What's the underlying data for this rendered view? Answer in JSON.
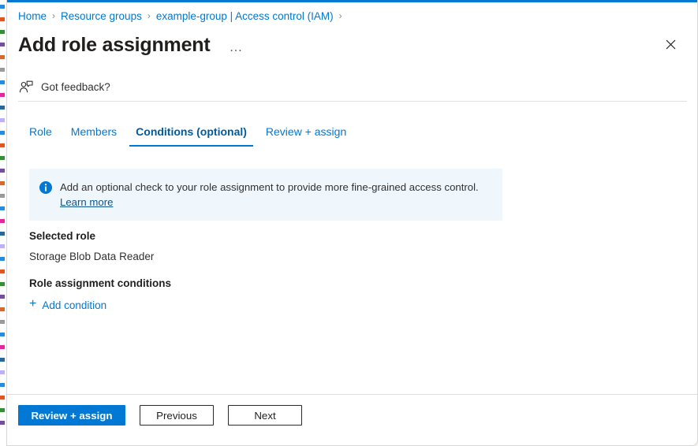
{
  "theme": {
    "accent": "#0078d4",
    "accent_dark": "#005a9e",
    "banner_bg": "#eff6fc",
    "link": "#0078d4",
    "banner_link": "#0f548c",
    "text": "#323130",
    "heading": "#201f1e",
    "divider": "#e1dfdd"
  },
  "breadcrumb": {
    "items": [
      {
        "label": "Home"
      },
      {
        "label": "Resource groups"
      },
      {
        "label": "example-group | Access control (IAM)"
      }
    ],
    "separator": "›"
  },
  "header": {
    "title": "Add role assignment",
    "more_label": "…",
    "more_icon": "ellipsis-icon",
    "close_icon": "close-icon"
  },
  "feedback": {
    "label": "Got feedback?",
    "icon": "feedback-person-icon"
  },
  "tabs": [
    {
      "label": "Role",
      "active": false
    },
    {
      "label": "Members",
      "active": false
    },
    {
      "label": "Conditions (optional)",
      "active": true
    },
    {
      "label": "Review + assign",
      "active": false
    }
  ],
  "info_banner": {
    "icon": "info-circle-icon",
    "text": "Add an optional check to your role assignment to provide more fine-grained access control. ",
    "link_label": "Learn more"
  },
  "sections": {
    "selected_role": {
      "heading": "Selected role",
      "value": "Storage Blob Data Reader"
    },
    "conditions": {
      "heading": "Role assignment conditions",
      "add_label": "Add condition",
      "add_icon": "plus-icon",
      "plus_glyph": "+"
    }
  },
  "footer": {
    "buttons": [
      {
        "label": "Review + assign",
        "style": "primary"
      },
      {
        "label": "Previous",
        "style": "secondary"
      },
      {
        "label": "Next",
        "style": "secondary"
      }
    ]
  }
}
